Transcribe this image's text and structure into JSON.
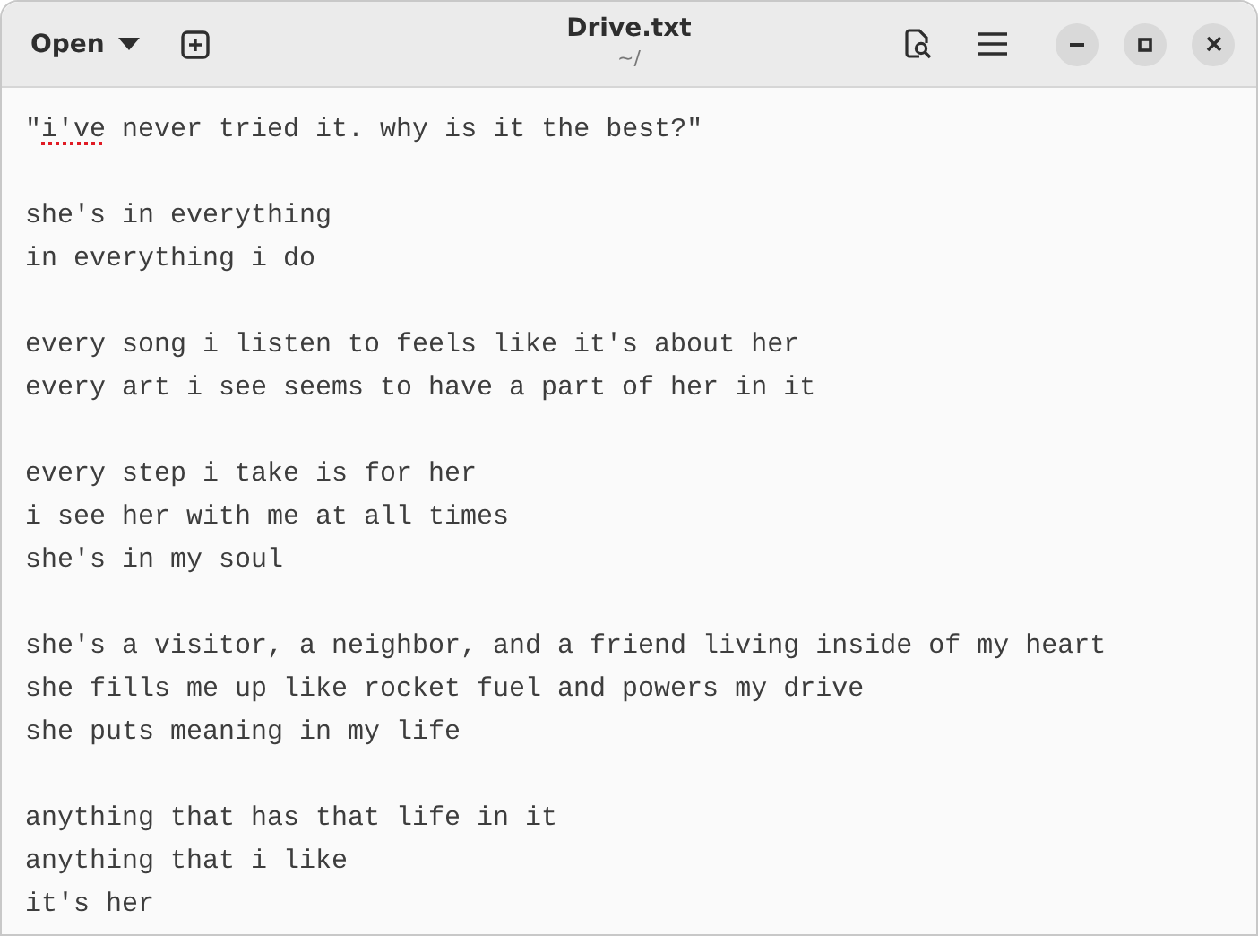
{
  "window": {
    "title": "Drive.txt",
    "subtitle": "~/"
  },
  "header": {
    "open_button": "Open"
  },
  "lines": [
    {
      "kind": "text",
      "segments": [
        {
          "text": "\"",
          "misspelled": false
        },
        {
          "text": "i've",
          "misspelled": true
        },
        {
          "text": " never tried it. why is it the best?\"",
          "misspelled": false
        }
      ]
    },
    {
      "kind": "blank"
    },
    {
      "kind": "text",
      "segments": [
        {
          "text": "she's in everything",
          "misspelled": false
        }
      ]
    },
    {
      "kind": "text",
      "segments": [
        {
          "text": "in everything i do",
          "misspelled": false
        }
      ]
    },
    {
      "kind": "blank"
    },
    {
      "kind": "text",
      "segments": [
        {
          "text": "every song i listen to feels like it's about her",
          "misspelled": false
        }
      ]
    },
    {
      "kind": "text",
      "segments": [
        {
          "text": "every art i see seems to have a part of her in it",
          "misspelled": false
        }
      ]
    },
    {
      "kind": "blank"
    },
    {
      "kind": "text",
      "segments": [
        {
          "text": "every step i take is for her",
          "misspelled": false
        }
      ]
    },
    {
      "kind": "text",
      "segments": [
        {
          "text": "i see her with me at all times",
          "misspelled": false
        }
      ]
    },
    {
      "kind": "text",
      "segments": [
        {
          "text": "she's in my soul",
          "misspelled": false
        }
      ]
    },
    {
      "kind": "blank"
    },
    {
      "kind": "text",
      "segments": [
        {
          "text": "she's a visitor, a neighbor, and a friend living inside of my heart",
          "misspelled": false
        }
      ]
    },
    {
      "kind": "text",
      "segments": [
        {
          "text": "she fills me up like rocket fuel and powers my drive",
          "misspelled": false
        }
      ]
    },
    {
      "kind": "text",
      "segments": [
        {
          "text": "she puts meaning in my life",
          "misspelled": false
        }
      ]
    },
    {
      "kind": "blank"
    },
    {
      "kind": "text",
      "segments": [
        {
          "text": "anything that has that life in it",
          "misspelled": false
        }
      ]
    },
    {
      "kind": "text",
      "segments": [
        {
          "text": "anything that i like",
          "misspelled": false
        }
      ]
    },
    {
      "kind": "text",
      "segments": [
        {
          "text": "it's her",
          "misspelled": false
        }
      ]
    }
  ]
}
